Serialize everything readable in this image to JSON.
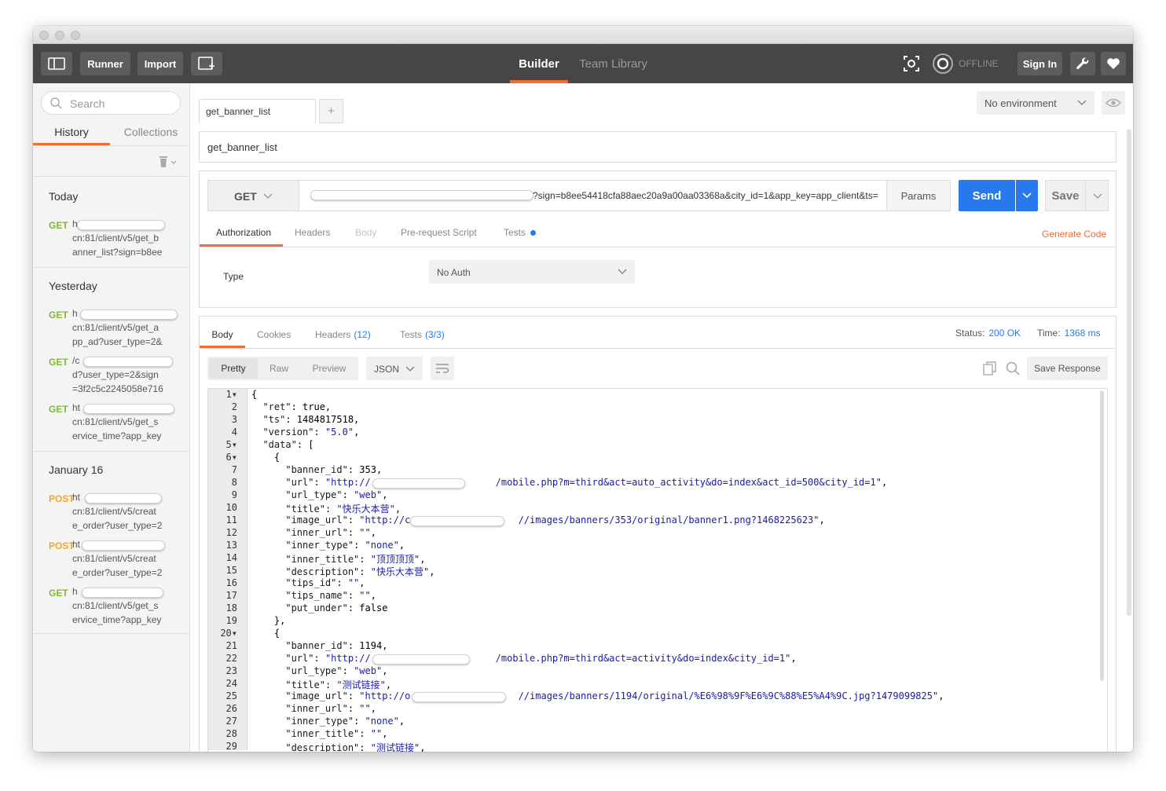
{
  "topbar": {
    "runner": "Runner",
    "import": "Import",
    "builder": "Builder",
    "team_library": "Team Library",
    "offline": "OFFLINE",
    "sign_in": "Sign In"
  },
  "sidebar": {
    "search_placeholder": "Search",
    "tab_history": "History",
    "tab_collections": "Collections",
    "groups": [
      {
        "day": "Today",
        "items": [
          {
            "method": "GET",
            "line1": "h",
            "line2": "cn:81/client/v5/get_b",
            "line3": "anner_list?sign=b8ee"
          }
        ]
      },
      {
        "day": "Yesterday",
        "items": [
          {
            "method": "GET",
            "line1": "h",
            "line2": "cn:81/client/v5/get_a",
            "line3": "pp_ad?user_type=2&"
          },
          {
            "method": "GET",
            "line1": "/c",
            "line2": "d?user_type=2&sign",
            "line3": "=3f2c5c2245058e716"
          },
          {
            "method": "GET",
            "line1": "ht",
            "line2": "cn:81/client/v5/get_s",
            "line3": "ervice_time?app_key"
          }
        ]
      },
      {
        "day": "January 16",
        "items": [
          {
            "method": "POST",
            "line1": "ht",
            "line2": "cn:81/client/v5/creat",
            "line3": "e_order?user_type=2"
          },
          {
            "method": "POST",
            "line1": "ht",
            "line2": "cn:81/client/v5/creat",
            "line3": "e_order?user_type=2"
          },
          {
            "method": "GET",
            "line1": "h",
            "line2": "cn:81/client/v5/get_s",
            "line3": "ervice_time?app_key"
          }
        ]
      }
    ]
  },
  "request": {
    "tab_name": "get_banner_list",
    "add_tab": "+",
    "environment": "No environment",
    "name": "get_banner_list",
    "method": "GET",
    "url_visible": "?sign=b8ee54418cfa88aec20a9a00aa03368a&city_id=1&app_key=app_client&ts=",
    "params": "Params",
    "send": "Send",
    "save": "Save",
    "tabs": [
      "Authorization",
      "Headers",
      "Body",
      "Pre-request Script",
      "Tests"
    ],
    "generate_code": "Generate Code",
    "auth_type_label": "Type",
    "auth_type_value": "No Auth"
  },
  "response": {
    "tabs": {
      "body": "Body",
      "cookies": "Cookies",
      "headers": "Headers",
      "headers_count": "(12)",
      "tests": "Tests",
      "tests_count": "(3/3)"
    },
    "status_label": "Status:",
    "status_value": "200 OK",
    "time_label": "Time:",
    "time_value": "1368 ms",
    "view_modes": [
      "Pretty",
      "Raw",
      "Preview"
    ],
    "format": "JSON",
    "save_response": "Save Response",
    "line_numbers": [
      "1",
      "2",
      "3",
      "4",
      "5",
      "6",
      "7",
      "8",
      "9",
      "10",
      "11",
      "12",
      "13",
      "14",
      "15",
      "16",
      "17",
      "18",
      "19",
      "20",
      "21",
      "22",
      "23",
      "24",
      "25",
      "26",
      "27",
      "28",
      "29"
    ],
    "code_lines": [
      "{",
      "  \"ret\": true,",
      "  \"ts\": 1484817518,",
      "  \"version\": \"5.0\",",
      "  \"data\": [",
      "    {",
      "      \"banner_id\": 353,",
      "      \"url\": \"http://                      /mobile.php?m=third&act=auto_activity&do=index&act_id=500&city_id=1\",",
      "      \"url_type\": \"web\",",
      "      \"title\": \"快乐大本营\",",
      "      \"image_url\": \"http://c                   //images/banners/353/original/banner1.png?1468225623\",",
      "      \"inner_url\": \"\",",
      "      \"inner_type\": \"none\",",
      "      \"inner_title\": \"顶顶顶顶\",",
      "      \"description\": \"快乐大本营\",",
      "      \"tips_id\": \"\",",
      "      \"tips_name\": \"\",",
      "      \"put_under\": false",
      "    },",
      "    {",
      "      \"banner_id\": 1194,",
      "      \"url\": \"http://                      /mobile.php?m=third&act=activity&do=index&city_id=1\",",
      "      \"url_type\": \"web\",",
      "      \"title\": \"测试链接\",",
      "      \"image_url\": \"http://o                   //images/banners/1194/original/%E6%98%9F%E6%9C%88%E5%A4%9C.jpg?1479099825\",",
      "      \"inner_url\": \"\",",
      "      \"inner_type\": \"none\",",
      "      \"inner_title\": \"\",",
      "      \"description\": \"测试链接\","
    ]
  }
}
